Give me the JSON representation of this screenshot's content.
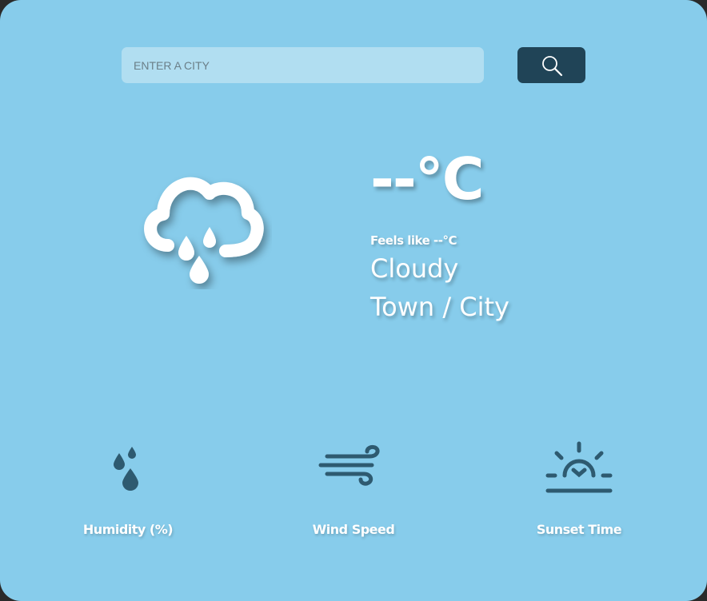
{
  "search": {
    "placeholder": "ENTER A CITY",
    "value": "",
    "button_icon": "search-icon"
  },
  "current": {
    "icon": "cloud-rain-icon",
    "temperature": "--°C",
    "feels_like": "Feels like --°C",
    "condition": "Cloudy",
    "location": "Town / City"
  },
  "stats": [
    {
      "icon": "humidity-icon",
      "label": "Humidity (%)"
    },
    {
      "icon": "wind-icon",
      "label": "Wind Speed"
    },
    {
      "icon": "sunset-icon",
      "label": "Sunset Time"
    }
  ],
  "colors": {
    "background": "#87cceb",
    "search_field": "#b1def1",
    "search_button": "#204457",
    "stat_icon": "#2e5a70",
    "text": "#ffffff"
  }
}
